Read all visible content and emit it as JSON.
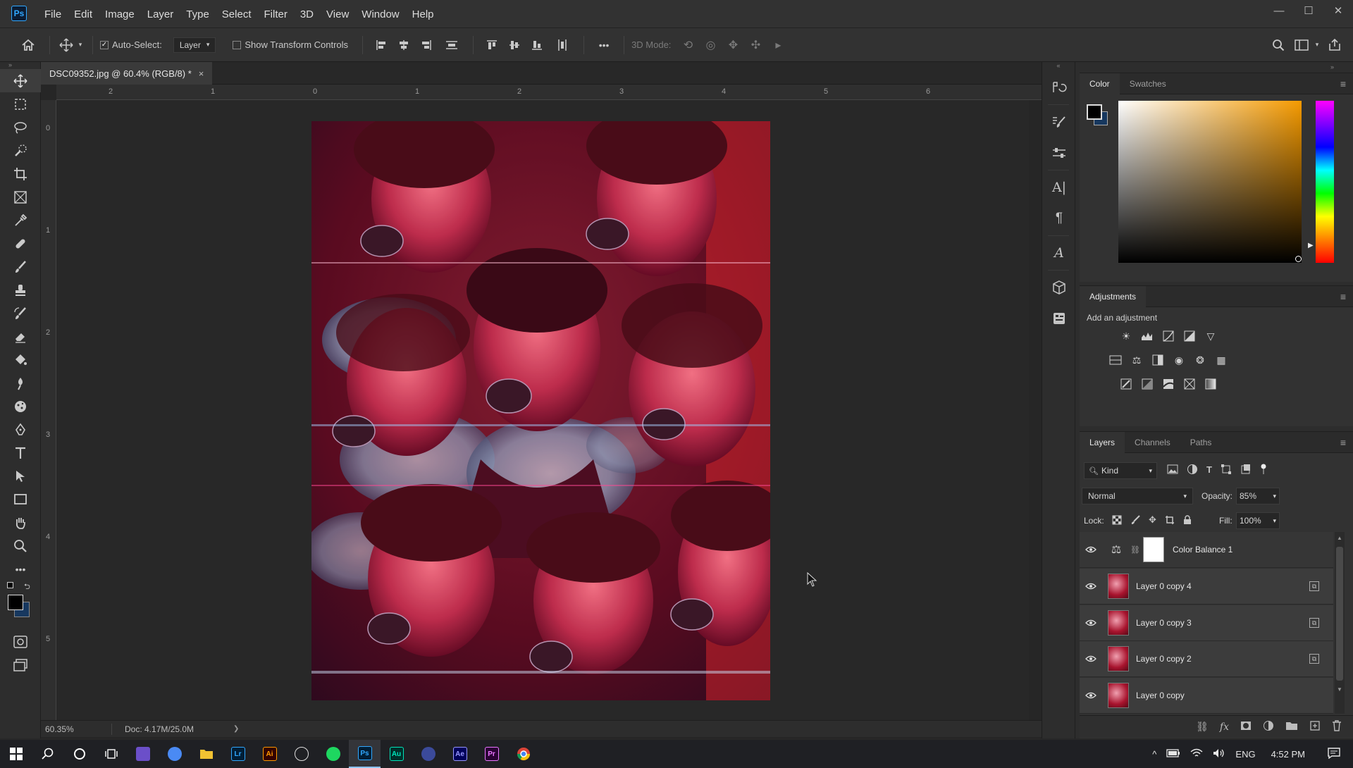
{
  "app": {
    "logo": "Ps"
  },
  "menu": [
    "File",
    "Edit",
    "Image",
    "Layer",
    "Type",
    "Select",
    "Filter",
    "3D",
    "View",
    "Window",
    "Help"
  ],
  "window_controls": {
    "minimize": "—",
    "maximize": "☐",
    "close": "✕"
  },
  "options_bar": {
    "auto_select_label": "Auto-Select:",
    "auto_select_checked": "✓",
    "target_value": "Layer",
    "show_transform_label": "Show Transform Controls",
    "mode_3d_label": "3D Mode:",
    "more": "•••"
  },
  "document": {
    "tab_title": "DSC09352.jpg @ 60.4% (RGB/8) *",
    "close": "×",
    "ruler_h_labels": [
      "2",
      "1",
      "0",
      "1",
      "2",
      "3",
      "4",
      "5",
      "6"
    ],
    "ruler_v_labels": [
      "0",
      "1",
      "2",
      "3",
      "4",
      "5"
    ]
  },
  "status": {
    "zoom": "60.35%",
    "doc": "Doc: 4.17M/25.0M",
    "arrow": "❯"
  },
  "color_panel": {
    "tabs": [
      "Color",
      "Swatches"
    ],
    "active": "Color",
    "fg_color": "#000000",
    "bg_color": "#17385f"
  },
  "adjustments_panel": {
    "title": "Adjustments",
    "subtitle": "Add an adjustment"
  },
  "layers_panel": {
    "tabs": [
      "Layers",
      "Channels",
      "Paths"
    ],
    "kind_label": "Kind",
    "blend_mode": "Normal",
    "opacity_label": "Opacity:",
    "opacity_value": "85%",
    "lock_label": "Lock:",
    "fill_label": "Fill:",
    "fill_value": "100%",
    "layers": [
      {
        "name": "Color Balance 1"
      },
      {
        "name": "Layer 0 copy 4"
      },
      {
        "name": "Layer 0 copy 3"
      },
      {
        "name": "Layer 0 copy 2"
      },
      {
        "name": "Layer 0 copy"
      }
    ]
  },
  "taskbar": {
    "apps": [
      {
        "icon": "Lr",
        "color": "#31a8ff",
        "bg": "#001e36"
      },
      {
        "icon": "Ai",
        "color": "#ff9a00",
        "bg": "#330000"
      },
      {
        "icon": "Ps",
        "color": "#31a8ff",
        "bg": "#001e36"
      },
      {
        "icon": "Au",
        "color": "#00e4bb",
        "bg": "#002f2a"
      },
      {
        "icon": "Ae",
        "color": "#9999ff",
        "bg": "#00005b"
      },
      {
        "icon": "Pr",
        "color": "#ea77ff",
        "bg": "#2a0034"
      }
    ],
    "lang": "ENG",
    "time": "4:52 PM"
  }
}
